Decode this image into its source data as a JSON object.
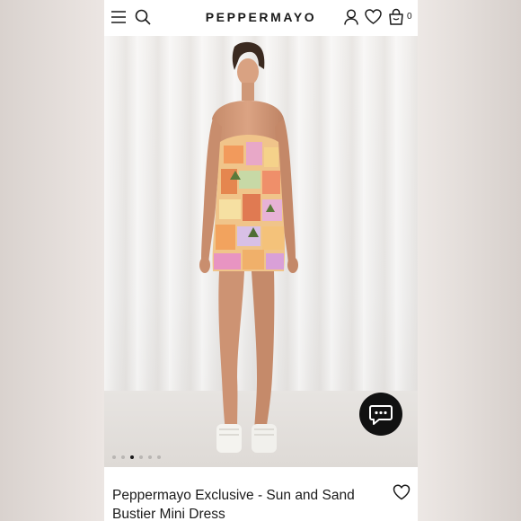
{
  "header": {
    "brand": "PEPPERMAYO",
    "bag_count": "0",
    "icons": {
      "menu": "hamburger-menu-icon",
      "search": "search-icon",
      "account": "user-icon",
      "wishlist": "heart-icon",
      "bag": "shopping-bag-icon"
    }
  },
  "gallery": {
    "image": "model wearing strapless printed mini dress and white platform sandals",
    "total_images": 6,
    "active_index": 3
  },
  "chat": {
    "icon": "chat-bubble-icon"
  },
  "product": {
    "title": "Peppermayo Exclusive - Sun and Sand Bustier Mini Dress",
    "wishlist_icon": "heart-outline-icon"
  },
  "colors": {
    "brand_text": "#1a1a1a",
    "chat_button": "#111111",
    "page_background": "#ffffff"
  }
}
